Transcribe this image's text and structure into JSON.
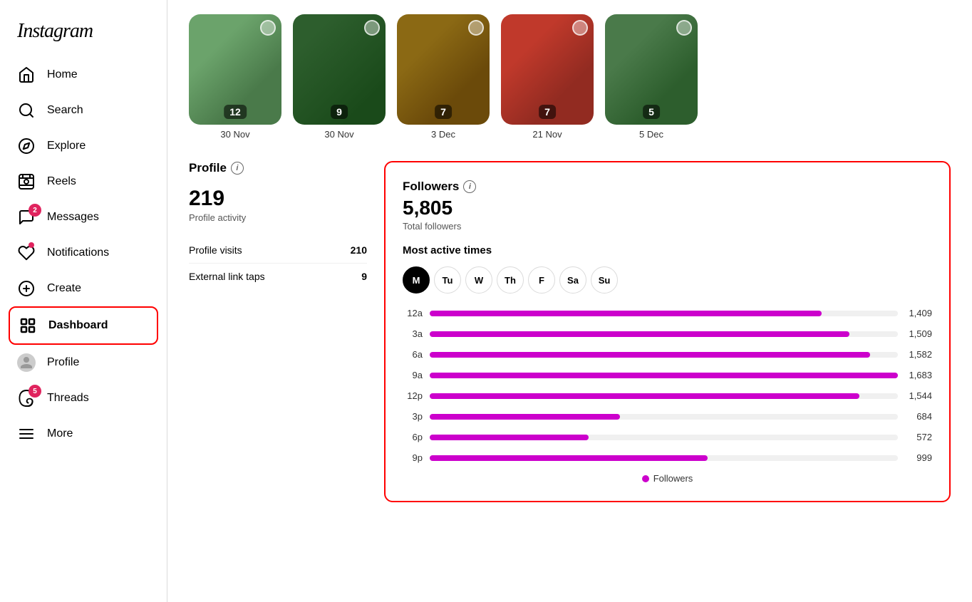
{
  "app": {
    "logo": "Instagram"
  },
  "sidebar": {
    "items": [
      {
        "id": "home",
        "label": "Home",
        "icon": "🏠",
        "badge": null
      },
      {
        "id": "search",
        "label": "Search",
        "icon": "🔍",
        "badge": null
      },
      {
        "id": "explore",
        "label": "Explore",
        "icon": "🧭",
        "badge": null
      },
      {
        "id": "reels",
        "label": "Reels",
        "icon": "🎬",
        "badge": null
      },
      {
        "id": "messages",
        "label": "Messages",
        "icon": "✉️",
        "badge": "2"
      },
      {
        "id": "notifications",
        "label": "Notifications",
        "icon": "❤️",
        "badge": "•"
      },
      {
        "id": "create",
        "label": "Create",
        "icon": "➕",
        "badge": null
      },
      {
        "id": "dashboard",
        "label": "Dashboard",
        "icon": "📊",
        "badge": null
      },
      {
        "id": "profile",
        "label": "Profile",
        "icon": "👤",
        "badge": null
      },
      {
        "id": "threads",
        "label": "Threads",
        "icon": "🔄",
        "badge": "5"
      },
      {
        "id": "more",
        "label": "More",
        "icon": "☰",
        "badge": null
      }
    ]
  },
  "stories": [
    {
      "count": 12,
      "date": "30 Nov"
    },
    {
      "count": 9,
      "date": "30 Nov"
    },
    {
      "count": 7,
      "date": "3 Dec"
    },
    {
      "count": 7,
      "date": "21 Nov"
    },
    {
      "count": 5,
      "date": "5 Dec"
    }
  ],
  "profile_panel": {
    "title": "Profile",
    "total": "219",
    "total_label": "Profile activity",
    "stats": [
      {
        "label": "Profile visits",
        "value": "210"
      },
      {
        "label": "External link taps",
        "value": "9"
      }
    ]
  },
  "followers_panel": {
    "title": "Followers",
    "total": "5,805",
    "total_label": "Total followers",
    "section_label": "Most active times",
    "days": [
      {
        "label": "M",
        "active": true
      },
      {
        "label": "Tu",
        "active": false
      },
      {
        "label": "W",
        "active": false
      },
      {
        "label": "Th",
        "active": false
      },
      {
        "label": "F",
        "active": false
      },
      {
        "label": "Sa",
        "active": false
      },
      {
        "label": "Su",
        "active": false
      }
    ],
    "bars": [
      {
        "time": "12a",
        "value": 1409,
        "max": 1800
      },
      {
        "time": "3a",
        "value": 1509,
        "max": 1800
      },
      {
        "time": "6a",
        "value": 1582,
        "max": 1800
      },
      {
        "time": "9a",
        "value": 1683,
        "max": 1800
      },
      {
        "time": "12p",
        "value": 1544,
        "max": 1800
      },
      {
        "time": "3p",
        "value": 684,
        "max": 1800
      },
      {
        "time": "6p",
        "value": 572,
        "max": 1800
      },
      {
        "time": "9p",
        "value": 999,
        "max": 1800
      }
    ],
    "legend_label": "Followers"
  }
}
